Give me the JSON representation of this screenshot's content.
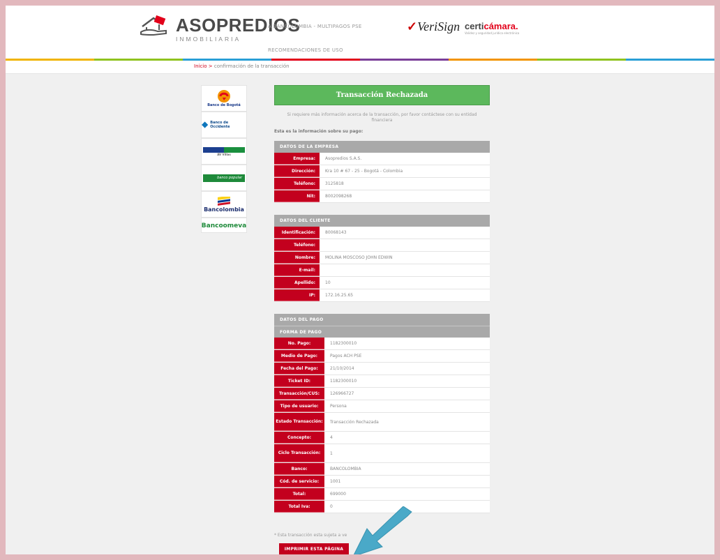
{
  "header": {
    "brand_name": "ASOPREDIOS",
    "brand_sub": "INMOBILIARIA",
    "nav_link_1": "A BANCOLOMBIA - MULTIPAGOS PSE",
    "nav_link_2": "RECOMENDACIONES DE USO",
    "verisign": "VeriSign",
    "certicamara_a": "certi",
    "certicamara_b": "cámara.",
    "certicamara_tag": "Validez y seguridad jurídica electrónica",
    "stripe_colors": [
      "#f0b400",
      "#8fc31f",
      "#2a9fd6",
      "#e2001a",
      "#7a3e98",
      "#f29400",
      "#8fc31f",
      "#2a9fd6"
    ]
  },
  "breadcrumb": {
    "home": "Inicio",
    "separator": ">",
    "current": "confirmación de la transacción"
  },
  "banks": [
    {
      "name": "Banco de Bogotá"
    },
    {
      "name": "Banco de Occidente"
    },
    {
      "name": "AV Villas"
    },
    {
      "name": "banco popular"
    },
    {
      "name": "Bancolombia"
    },
    {
      "name": "Bancoomeva"
    }
  ],
  "main": {
    "status": "Transacción Rechazada",
    "status_color": "#5cb85c",
    "notice": "Si requiere más información acerca de la transacción, por favor contáctese con su entidad financiera",
    "intro": "Esta es la información sobre su pago:",
    "company": {
      "title": "DATOS DE LA EMPRESA",
      "rows": [
        {
          "label": "Empresa:",
          "value": "Asopredios S.A.S."
        },
        {
          "label": "Dirección:",
          "value": "Kra 10 # 67 - 25 - Bogotá - Colombia"
        },
        {
          "label": "Teléfono:",
          "value": "3125818"
        },
        {
          "label": "Nit:",
          "value": "8002098268"
        }
      ]
    },
    "client": {
      "title": "DATOS DEL CLIENTE",
      "rows": [
        {
          "label": "Identificación:",
          "value": "80068143"
        },
        {
          "label": "Teléfono:",
          "value": ""
        },
        {
          "label": "Nombre:",
          "value": "MOLINA MOSCOSO JOHN EDWIN"
        },
        {
          "label": "E-mail:",
          "value": ""
        },
        {
          "label": "Apellido:",
          "value": "10"
        },
        {
          "label": "IP:",
          "value": "172.16.25.65"
        }
      ]
    },
    "payment": {
      "title": "DATOS DEL PAGO",
      "subtitle": "FORMA DE PAGO",
      "rows": [
        {
          "label": "No. Pago:",
          "value": "1182300010"
        },
        {
          "label": "Medio de Pago:",
          "value": "Pagos ACH PSE"
        },
        {
          "label": "Fecha del Pago:",
          "value": "21/10/2014"
        },
        {
          "label": "Ticket ID:",
          "value": "1182300010"
        },
        {
          "label": "Transacción/CUS:",
          "value": "126966727"
        },
        {
          "label": "Tipo de usuario:",
          "value": "Persona"
        },
        {
          "label": "Estado Transacción:",
          "value": "Transacción Rechazada"
        },
        {
          "label": "Concepto:",
          "value": "4"
        },
        {
          "label": "Ciclo Transacción:",
          "value": "1"
        },
        {
          "label": "Banco:",
          "value": "BANCOLOMBIA"
        },
        {
          "label": "Cód. de servicio:",
          "value": "1001"
        },
        {
          "label": "Total:",
          "value": "699000"
        },
        {
          "label": "Total Iva:",
          "value": "0"
        }
      ]
    },
    "footnote": "* Esta transacción esta sujeta a ve",
    "print_label": "IMPRIMIR ESTA PÁGINA"
  }
}
